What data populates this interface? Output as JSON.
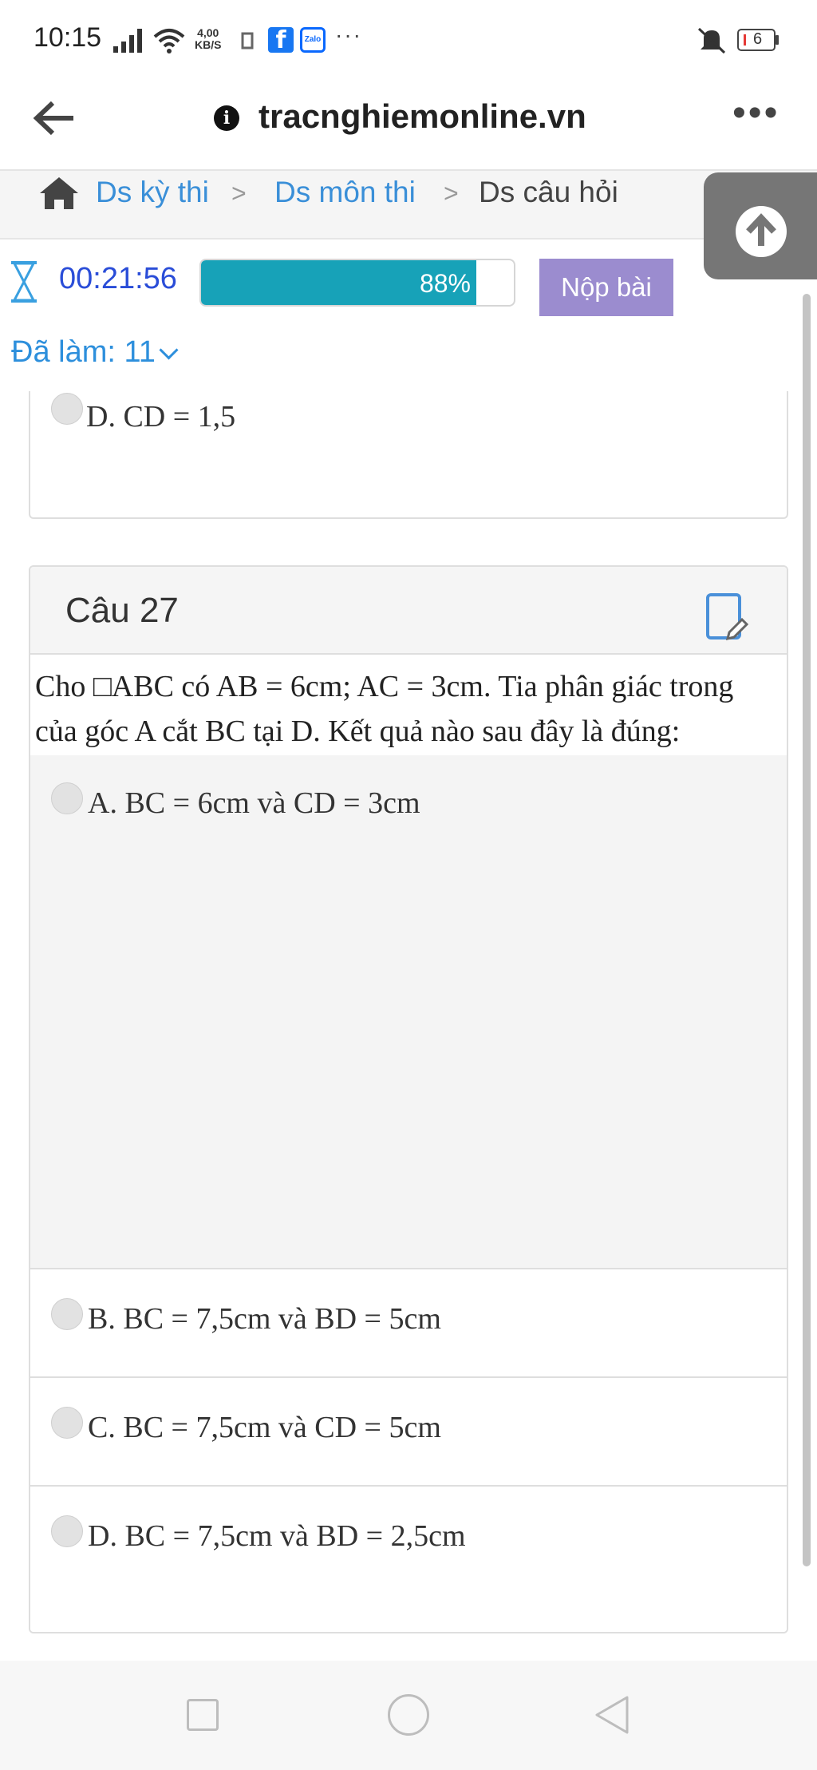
{
  "status_bar": {
    "time": "10:15",
    "net_speed_top": "4,00",
    "net_speed_bottom": "KB/S",
    "more": "···",
    "battery": "6"
  },
  "browser": {
    "url": "tracnghiemonline.vn",
    "menu": "•••"
  },
  "breadcrumb": {
    "items": [
      "Ds kỳ thi",
      "Ds môn thi",
      "Ds câu hỏi"
    ],
    "separator": ">"
  },
  "exam": {
    "timer": "00:21:56",
    "progress_percent": 88,
    "progress_label": "88%",
    "submit_label": "Nộp bài",
    "done_label": "Đã làm: 11"
  },
  "previous_question": {
    "last_option": "D. CD = 1,5"
  },
  "question": {
    "title": "Câu 27",
    "text": "Cho □ABC có AB = 6cm; AC = 3cm. Tia phân giác trong của góc A cắt BC tại D. Kết quả nào sau đây là đúng:",
    "options": [
      "A. BC = 6cm và CD = 3cm",
      "B. BC = 7,5cm và BD = 5cm",
      "C. BC = 7,5cm và CD = 5cm",
      "D. BC = 7,5cm và BD = 2,5cm"
    ]
  },
  "colors": {
    "progress": "#17a2b8",
    "submit": "#9b8ccf",
    "link": "#3a8fd8",
    "timer": "#2a4dd8"
  }
}
